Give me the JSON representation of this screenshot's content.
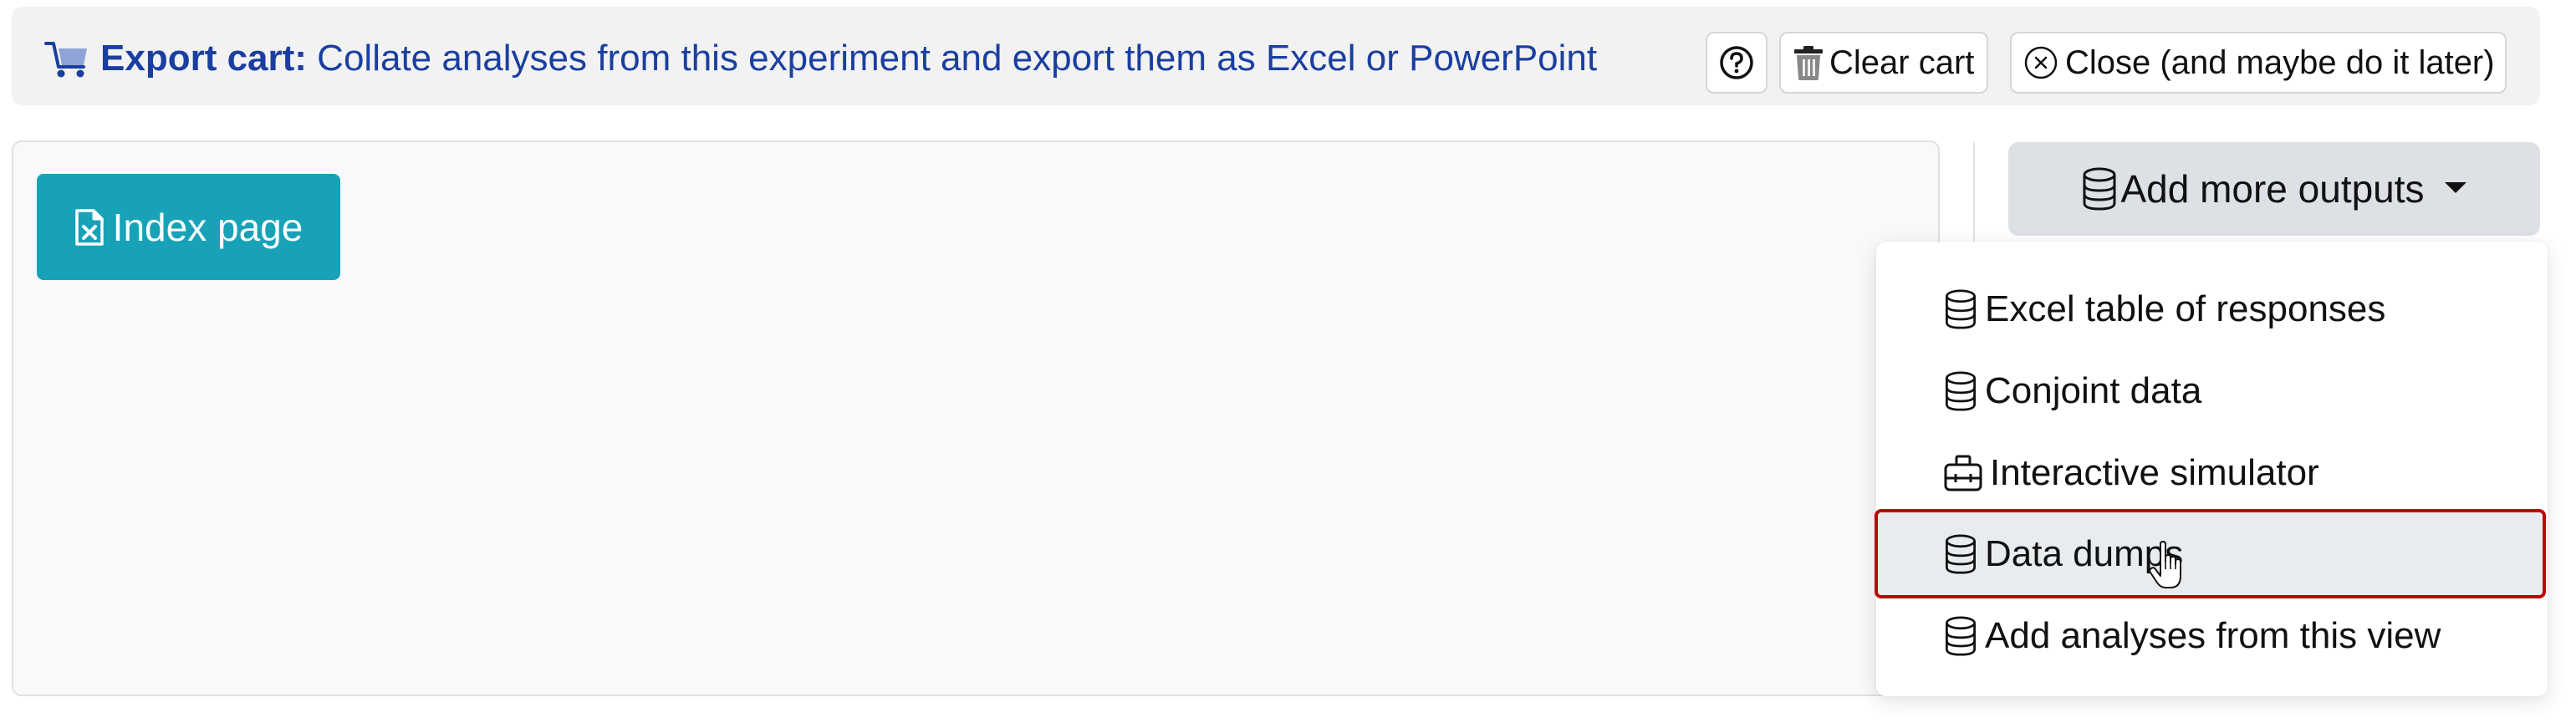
{
  "header": {
    "title_bold": "Export cart:",
    "title_rest": " Collate analyses from this experiment and export them as Excel or PowerPoint",
    "help_icon": "question-circle-icon",
    "clear_cart_label": "Clear cart",
    "clear_cart_icon": "trash-icon",
    "close_label": "Close (and maybe do it later)",
    "close_icon": "x-circle-icon",
    "title_color": "#1a3fa0"
  },
  "main": {
    "index_button_label": "Index page",
    "index_button_icon": "file-excel-icon",
    "index_button_color": "#17a2b8"
  },
  "add_outputs": {
    "button_label": "Add more outputs",
    "button_icon": "database-icon",
    "menu_items": [
      {
        "label": "Excel table of responses",
        "icon": "database-icon",
        "active": false
      },
      {
        "label": "Conjoint data",
        "icon": "database-icon",
        "active": false
      },
      {
        "label": "Interactive simulator",
        "icon": "toolbox-icon",
        "active": false
      },
      {
        "label": "Data dumps",
        "icon": "database-icon",
        "active": true
      },
      {
        "label": "Add analyses from this view",
        "icon": "database-icon",
        "active": false
      }
    ],
    "highlight_color": "#c00000"
  }
}
